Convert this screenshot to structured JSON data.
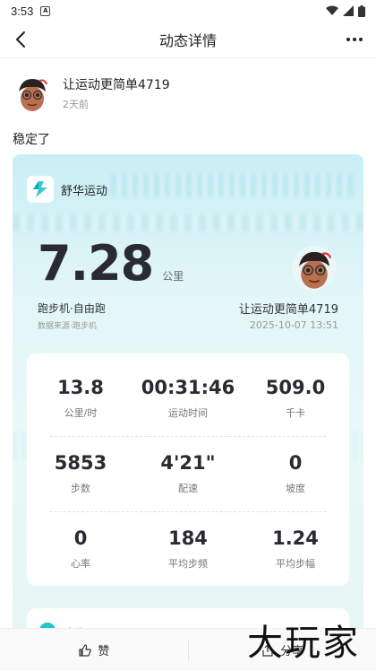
{
  "status_bar": {
    "time": "3:53",
    "sim_label": "A"
  },
  "header": {
    "title": "动态详情"
  },
  "post": {
    "author": "让运动更简单4719",
    "time_ago": "2天前",
    "text": "稳定了"
  },
  "card": {
    "brand_name": "舒华运动",
    "distance": "7.28",
    "distance_unit": "公里",
    "run_type": "跑步机·自由跑",
    "source": "数据来源·跑步机",
    "user_name": "让运动更简单4719",
    "date": "2025-10-07 13:51",
    "stats": [
      {
        "value": "13.8",
        "label": "公里/时"
      },
      {
        "value": "00:31:46",
        "label": "运动时间"
      },
      {
        "value": "509.0",
        "label": "千卡"
      },
      {
        "value": "5853",
        "label": "步数"
      },
      {
        "value": "4'21\"",
        "label": "配速"
      },
      {
        "value": "0",
        "label": "坡度"
      },
      {
        "value": "0",
        "label": "心率"
      },
      {
        "value": "184",
        "label": "平均步频"
      },
      {
        "value": "1.24",
        "label": "平均步幅"
      }
    ],
    "speed_label": "速度"
  },
  "bottom": {
    "like_label": "赞",
    "share_label": "分享"
  },
  "watermark": "大玩家",
  "colors": {
    "accent": "#1fc7c7",
    "card_bg": "#e3f6f8",
    "text_dark": "#2a2a33"
  },
  "icons": {
    "back": "chevron-left-icon",
    "more": "more-dots-icon",
    "like": "thumbs-up-icon",
    "share": "share-icon",
    "brand": "shuhua-logo-icon"
  }
}
